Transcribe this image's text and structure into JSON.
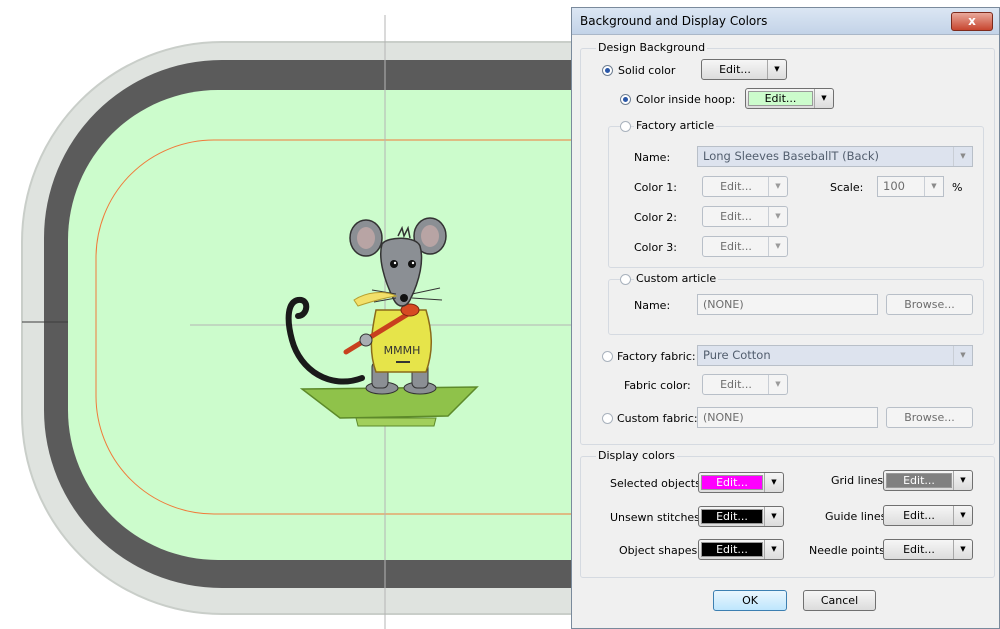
{
  "dialog": {
    "title": "Background and Display Colors",
    "close_glyph": "x",
    "design_background": {
      "label": "Design Background",
      "solid_color": {
        "label": "Solid color",
        "button": "Edit..."
      },
      "color_inside_hoop": {
        "label": "Color inside hoop:",
        "button": "Edit..."
      },
      "factory_article": {
        "label": "Factory article",
        "name_label": "Name:",
        "name_value": "Long Sleeves BaseballT (Back)",
        "color1_label": "Color 1:",
        "color2_label": "Color 2:",
        "color3_label": "Color 3:",
        "button": "Edit...",
        "scale_label": "Scale:",
        "scale_value": "100",
        "scale_unit": "%"
      },
      "custom_article": {
        "label": "Custom article",
        "name_label": "Name:",
        "name_value": "(NONE)",
        "browse": "Browse..."
      },
      "factory_fabric": {
        "label": "Factory fabric:",
        "value": "Pure Cotton",
        "fabric_color_label": "Fabric color:",
        "button": "Edit..."
      },
      "custom_fabric": {
        "label": "Custom fabric:",
        "value": "(NONE)",
        "browse": "Browse..."
      }
    },
    "display_colors": {
      "label": "Display colors",
      "selected_objects": {
        "label": "Selected objects:",
        "button": "Edit...",
        "color": "#ff00ff"
      },
      "unsewn_stitches": {
        "label": "Unsewn stitches:",
        "button": "Edit...",
        "color": "#000000"
      },
      "object_shapes": {
        "label": "Object shapes:",
        "button": "Edit...",
        "color": "#000000"
      },
      "grid_lines": {
        "label": "Grid lines:",
        "button": "Edit...",
        "color": "#808080"
      },
      "guide_lines": {
        "label": "Guide lines:",
        "button": "Edit...",
        "color": "#f0f0f0"
      },
      "needle_points": {
        "label": "Needle points:",
        "button": "Edit...",
        "color": "#f0f0f0"
      }
    },
    "ok": "OK",
    "cancel": "Cancel"
  },
  "canvas": {
    "hoop_color": "#ccfccc",
    "hoop_frame_color": "#5a5a5a",
    "embroidery_text": "MMMH"
  }
}
